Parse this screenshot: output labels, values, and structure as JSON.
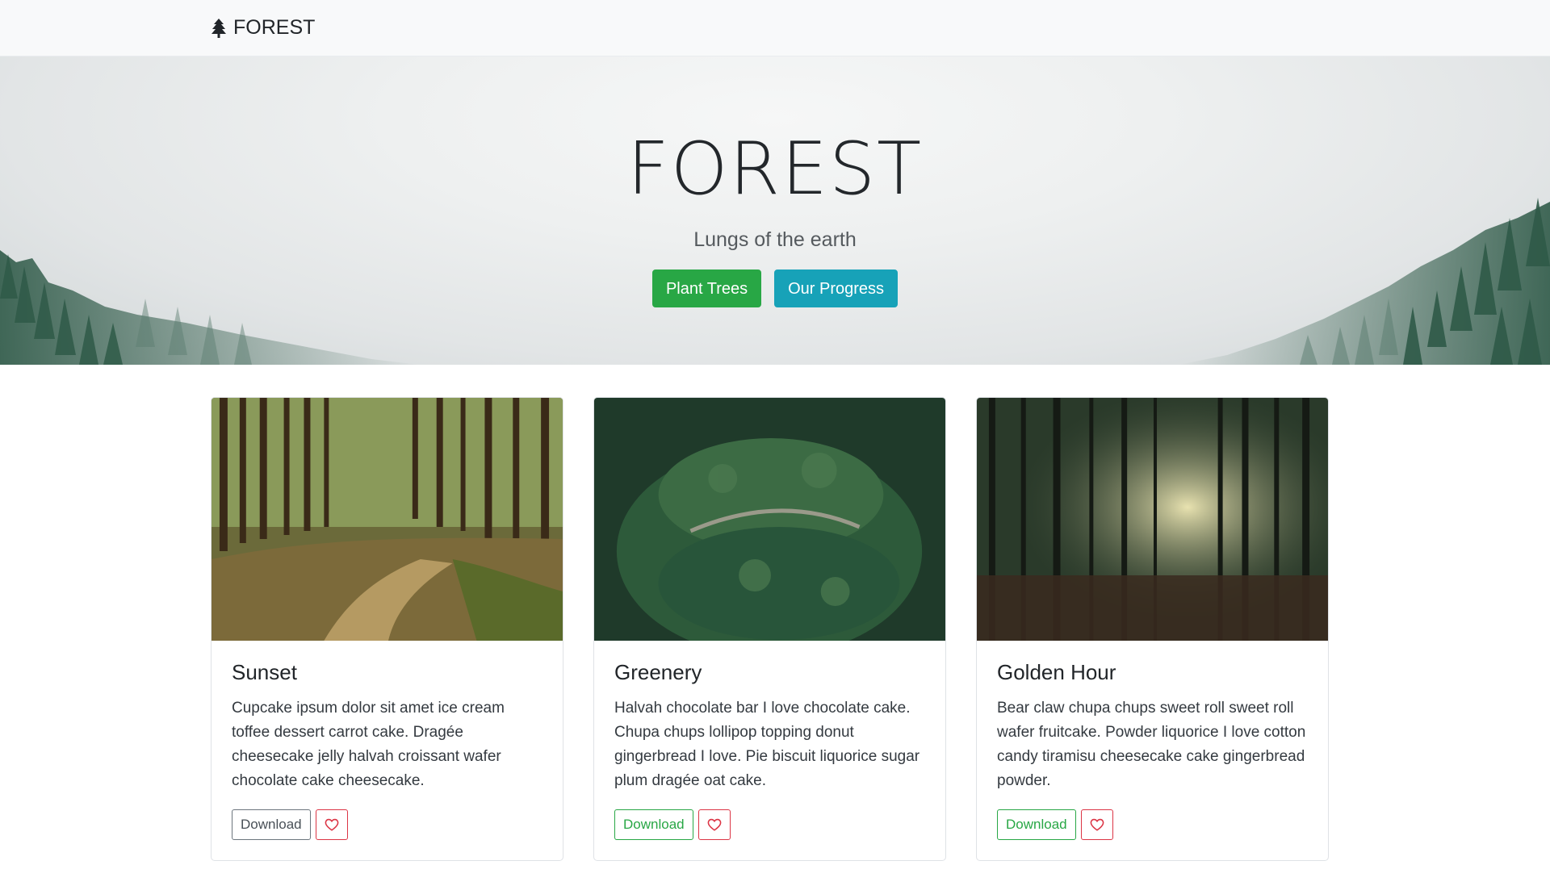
{
  "navbar": {
    "brand_text": "FOREST",
    "brand_icon": "tree-icon"
  },
  "hero": {
    "title": "FOREST",
    "subtitle": "Lungs of the earth",
    "primary_button": "Plant Trees",
    "secondary_button": "Our Progress"
  },
  "cards": [
    {
      "title": "Sunset",
      "text": "Cupcake ipsum dolor sit amet ice cream toffee dessert carrot cake. Dragée cheesecake jelly halvah croissant wafer chocolate cake cheesecake.",
      "download_label": "Download",
      "favorite_icon": "heart-icon"
    },
    {
      "title": "Greenery",
      "text": "Halvah chocolate bar I love chocolate cake. Chupa chups lollipop topping donut gingerbread I love. Pie biscuit liquorice sugar plum dragée oat cake.",
      "download_label": "Download",
      "favorite_icon": "heart-icon"
    },
    {
      "title": "Golden Hour",
      "text": "Bear claw chupa chups sweet roll sweet roll wafer fruitcake. Powder liquorice I love cotton candy tiramisu cheesecake cake gingerbread powder.",
      "download_label": "Download",
      "favorite_icon": "heart-icon"
    }
  ],
  "colors": {
    "success": "#28a745",
    "info": "#17a2b8",
    "danger": "#dc3545",
    "secondary": "#6c757d"
  }
}
